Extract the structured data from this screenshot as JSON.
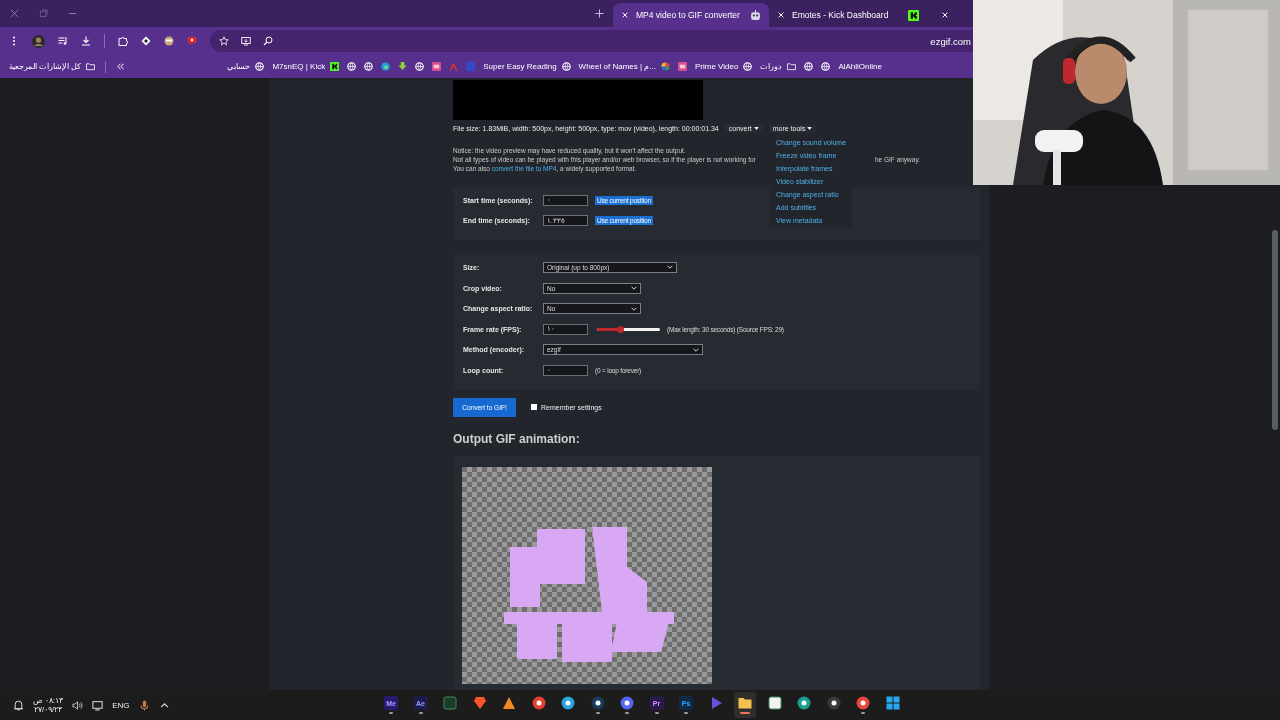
{
  "tabs": [
    {
      "title": "MP4 video to GIF converter",
      "selected": true
    },
    {
      "title": "Emotes - Kick Dashboard",
      "selected": false
    }
  ],
  "address_bar": {
    "url": "ezgif.com"
  },
  "all_bookmarks": {
    "label": "كل الإشارات المرجعية"
  },
  "bookmarks": [
    {
      "label": "حسابي",
      "kind": "globe"
    },
    {
      "label": "M7snEQ | Kick",
      "kind": "kick"
    },
    {
      "kind": "globe"
    },
    {
      "kind": "globe"
    },
    {
      "kind": "edge"
    },
    {
      "kind": "download"
    },
    {
      "kind": "globe"
    },
    {
      "kind": "tile"
    },
    {
      "kind": "pdf"
    },
    {
      "kind": "square"
    },
    {
      "label": "Super Easy Reading",
      "kind": "globe"
    },
    {
      "label": "Wheel of Names | م...",
      "kind": "wheel"
    },
    {
      "kind": "tile"
    },
    {
      "label": "Prime Video",
      "kind": "globe"
    },
    {
      "label": "دورات",
      "kind": "folder"
    },
    {
      "kind": "globe"
    },
    {
      "kind": "globe"
    },
    {
      "label": "AlAhliOnline"
    }
  ],
  "page": {
    "file_info": "File size: 1.83MiB, width: 500px, height: 500px, type: mov (video), length: 00:00:01.34",
    "convert_menu": "convert",
    "more_tools_menu": "more tools",
    "more_tools_items": [
      "Change sound volume",
      "Freeze video frame",
      "Interpolate frames",
      "Video stabilizer",
      "Change aspect ratio",
      "Add subtitles",
      "View metadata"
    ],
    "notice": "Notice: the video preview may have reduced quality, but it won't affect the output.",
    "notice_line_2_start": "Not all types of video can be played with this player and/or web browser, so if the player is not working for",
    "notice_line_2_end": "he GIF anyway.",
    "notice_line_3": {
      "before": "You can also ",
      "link": "convert the file to MP4",
      "after": ", a widely supported format."
    },
    "time_rows": [
      {
        "label": "Start time (seconds):",
        "value": "٠",
        "button": "Use current position"
      },
      {
        "label": "End time (seconds):",
        "value": "١.٣٣٥",
        "button": "Use current position"
      }
    ],
    "option_rows": [
      {
        "kind": "select",
        "label": "Size:",
        "value": "Original (up to 800px)"
      },
      {
        "kind": "select",
        "label": "Crop video:",
        "value": "No"
      },
      {
        "kind": "select",
        "label": "Change aspect ratio:",
        "value": "No"
      },
      {
        "kind": "slider",
        "label": "Frame rate (FPS):",
        "value": "١٠",
        "level": 0.37,
        "note": "(Max length: 30 seconds) (Source FPS: 29)"
      },
      {
        "kind": "select",
        "label": "Method (encoder):",
        "value": "ezgif"
      },
      {
        "kind": "text",
        "label": "Loop count:",
        "value": "٠",
        "note": "(0 = loop forever)"
      }
    ],
    "convert_button": "Convert to GIF!",
    "remember_settings": {
      "label": "Remember settings",
      "checked": false
    },
    "output_heading": "Output GIF animation:"
  },
  "taskbar": {
    "time": "٠٨:١٣ ص",
    "date": "٢٧/٠٩/٢٣",
    "language": "ENG",
    "apps": [
      {
        "kind": "me",
        "label": "Me",
        "running": true,
        "selected": false
      },
      {
        "kind": "ae",
        "label": "Ae",
        "running": true,
        "selected": false
      },
      {
        "kind": "excel",
        "running": false,
        "selected": false
      },
      {
        "kind": "brave",
        "running": false,
        "selected": false
      },
      {
        "kind": "arrow",
        "running": false,
        "selected": false
      },
      {
        "kind": "red",
        "running": false,
        "selected": false
      },
      {
        "kind": "telegram",
        "running": false,
        "selected": false
      },
      {
        "kind": "steam",
        "running": true,
        "selected": false
      },
      {
        "kind": "discord",
        "running": true,
        "selected": false
      },
      {
        "kind": "pr",
        "label": "Pr",
        "running": true,
        "selected": false
      },
      {
        "kind": "ps",
        "label": "Ps",
        "running": true,
        "selected": false
      },
      {
        "kind": "play",
        "running": false,
        "selected": false
      },
      {
        "kind": "folder",
        "running": true,
        "selected": true
      },
      {
        "kind": "store",
        "running": false,
        "selected": false
      },
      {
        "kind": "edge",
        "running": false,
        "selected": false
      },
      {
        "kind": "obs",
        "running": false,
        "selected": false
      },
      {
        "kind": "chrome",
        "running": true,
        "selected": false
      },
      {
        "kind": "windows",
        "running": false,
        "selected": false
      }
    ]
  }
}
